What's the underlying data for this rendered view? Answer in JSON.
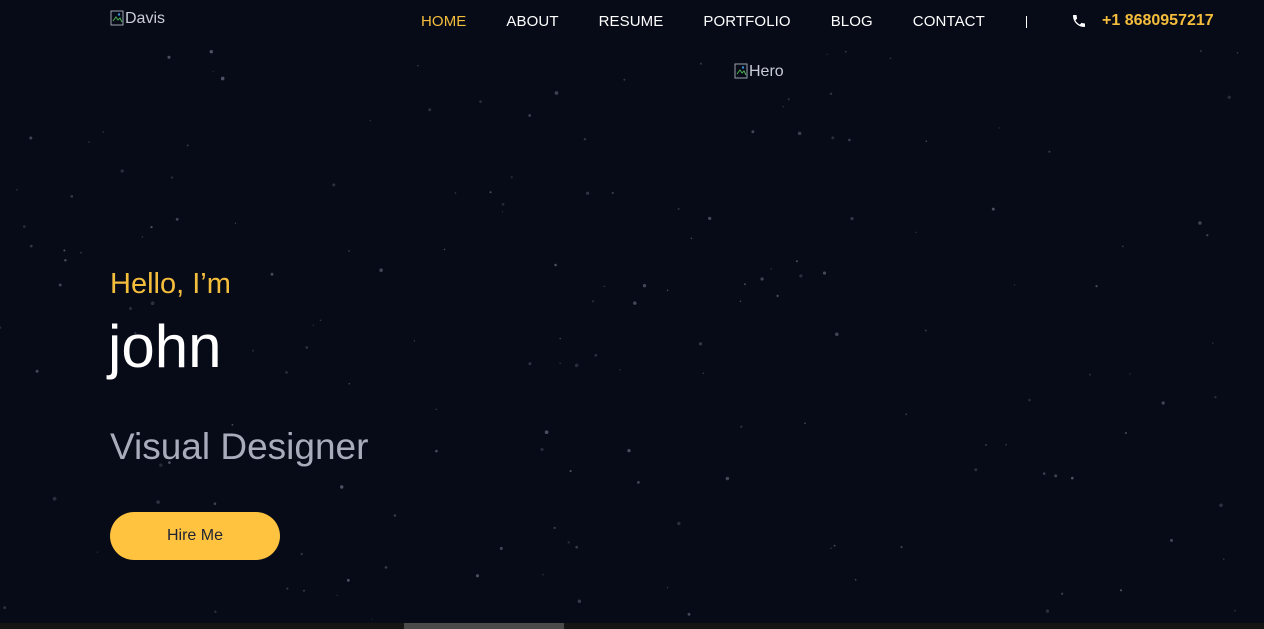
{
  "header": {
    "logo_alt": "Davis",
    "nav": [
      {
        "label": "HOME",
        "active": true
      },
      {
        "label": "ABOUT",
        "active": false
      },
      {
        "label": "RESUME",
        "active": false
      },
      {
        "label": "PORTFOLIO",
        "active": false
      },
      {
        "label": "BLOG",
        "active": false
      },
      {
        "label": "CONTACT",
        "active": false
      }
    ],
    "phone": "+1 8680957217"
  },
  "hero": {
    "image_alt": "Hero",
    "greeting": "Hello, I’m",
    "name": "john",
    "role": "Visual Designer",
    "cta_label": "Hire Me"
  },
  "colors": {
    "background": "#070b18",
    "accent": "#f5bd3c",
    "button": "#ffc340",
    "muted_text": "#a8acbb"
  },
  "icons": {
    "phone": "phone-icon",
    "broken_image": "broken-image-icon"
  }
}
